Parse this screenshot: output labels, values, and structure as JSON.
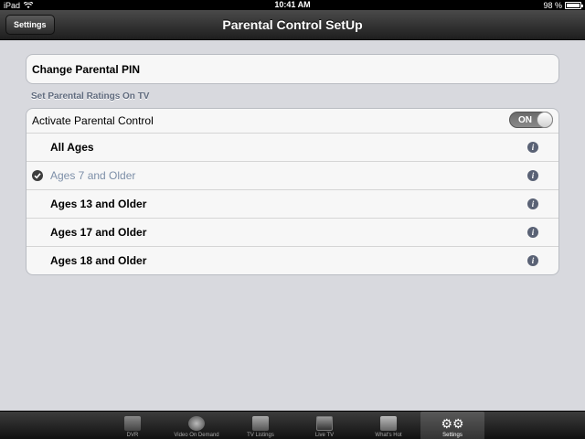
{
  "status": {
    "device": "iPad",
    "time": "10:41 AM",
    "battery_text": "98 %",
    "battery_level": 0.98
  },
  "nav": {
    "back_label": "Settings",
    "title": "Parental Control SetUp"
  },
  "pin_row": {
    "label": "Change Parental PIN"
  },
  "section_header": "Set Parental Ratings On TV",
  "activate": {
    "label": "Activate Parental Control",
    "toggle_label": "ON",
    "toggle_state": "on"
  },
  "ratings": [
    {
      "label": "All Ages",
      "selected": false,
      "icon": "info-icon"
    },
    {
      "label": "Ages 7 and Older",
      "selected": true,
      "icon": "info-icon"
    },
    {
      "label": "Ages 13 and Older",
      "selected": false,
      "icon": "info-icon"
    },
    {
      "label": "Ages 17 and Older",
      "selected": false,
      "icon": "info-icon"
    },
    {
      "label": "Ages 18 and Older",
      "selected": false,
      "icon": "info-icon"
    }
  ],
  "tabs": [
    {
      "label": "DVR",
      "icon": "dvr-icon",
      "active": false
    },
    {
      "label": "Video On Demand",
      "icon": "film-reel-icon",
      "active": false
    },
    {
      "label": "TV Listings",
      "icon": "listings-icon",
      "active": false
    },
    {
      "label": "Live TV",
      "icon": "tv-icon",
      "active": false
    },
    {
      "label": "What's Hot",
      "icon": "popcorn-icon",
      "active": false
    },
    {
      "label": "Settings",
      "icon": "gears-icon",
      "active": true
    }
  ],
  "colors": {
    "background": "#d8d9de",
    "section_header": "#5f6a7d",
    "selected_text": "#7d8fa8"
  }
}
